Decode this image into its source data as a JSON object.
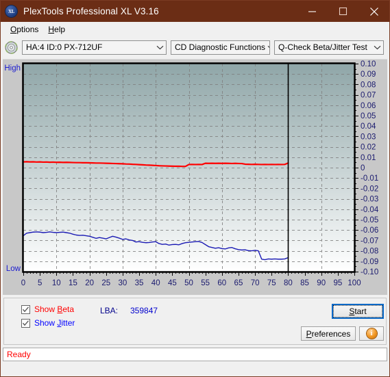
{
  "window": {
    "title": "PlexTools Professional XL V3.16",
    "icon": "xl-app-icon",
    "icon_text": "XL",
    "minimize": "minimize-icon",
    "maximize": "maximize-icon",
    "close": "close-icon",
    "titlebar_color": "#6b2d15"
  },
  "menu": {
    "items": [
      {
        "label": "Options",
        "accel": "O"
      },
      {
        "label": "Help",
        "accel": "H"
      }
    ]
  },
  "toolbar": {
    "disc_icon": "cd-disc-icon",
    "drive_select": {
      "value": "HA:4 ID:0  PX-712UF"
    },
    "function_select": {
      "value": "CD Diagnostic Functions"
    },
    "test_select": {
      "value": "Q-Check Beta/Jitter Test"
    }
  },
  "controls": {
    "show_beta": {
      "label_pre": "Show ",
      "accel": "B",
      "label_post": "eta",
      "checked": true,
      "color": "#ff0000"
    },
    "show_jitter": {
      "label_pre": "Show ",
      "accel": "J",
      "label_post": "itter",
      "checked": true,
      "color": "#0000ff"
    },
    "lba_label": "LBA:",
    "lba_value": "359847",
    "start_button": {
      "pre": "",
      "accel": "S",
      "post": "tart"
    },
    "preferences_button": {
      "pre": "",
      "accel": "P",
      "post": "references"
    },
    "info_button": {
      "icon": "info-icon",
      "glyph": "i"
    }
  },
  "status": {
    "text": "Ready",
    "color": "#ff0000"
  },
  "chart_data": {
    "type": "line",
    "title": "Q-Check Beta/Jitter Test",
    "xlabel": "",
    "ylabel": "",
    "xlim": [
      0,
      100
    ],
    "ylim": [
      -0.1,
      0.1
    ],
    "xticks": [
      0,
      5,
      10,
      15,
      20,
      25,
      30,
      35,
      40,
      45,
      50,
      55,
      60,
      65,
      70,
      75,
      80,
      85,
      90,
      95,
      100
    ],
    "yticks_right": [
      0.1,
      0.09,
      0.08,
      0.07,
      0.06,
      0.05,
      0.04,
      0.03,
      0.02,
      0.01,
      0,
      -0.01,
      -0.02,
      -0.03,
      -0.04,
      -0.05,
      -0.06,
      -0.07,
      -0.08,
      -0.09,
      -0.1
    ],
    "ylabel_top_left": "High",
    "ylabel_bottom_left": "Low",
    "grid": true,
    "grid_style": "dashed",
    "grid_color": "#808080",
    "background_gradient": [
      "#8fa6a8",
      "#ffffff"
    ],
    "progress_marker_x": 80,
    "legend": [
      {
        "name": "Beta",
        "color": "#ff0000"
      },
      {
        "name": "Jitter",
        "color": "#1a1ab4"
      }
    ],
    "series": [
      {
        "name": "Beta",
        "color": "#ff0000",
        "x": [
          0,
          1,
          2,
          3,
          4,
          5,
          6,
          7,
          8,
          9,
          10,
          11,
          12,
          13,
          14,
          15,
          16,
          17,
          18,
          19,
          20,
          21,
          22,
          23,
          24,
          25,
          26,
          27,
          28,
          29,
          30,
          31,
          32,
          33,
          34,
          35,
          36,
          37,
          38,
          39,
          40,
          41,
          42,
          43,
          44,
          45,
          46,
          47,
          48,
          49,
          50,
          51,
          52,
          53,
          54,
          55,
          56,
          57,
          58,
          59,
          60,
          61,
          62,
          63,
          64,
          65,
          66,
          67,
          68,
          69,
          70,
          71,
          72,
          73,
          74,
          75,
          76,
          77,
          78,
          79,
          80
        ],
        "y": [
          0.0055,
          0.0057,
          0.0055,
          0.0056,
          0.0054,
          0.0055,
          0.0053,
          0.0054,
          0.0052,
          0.0053,
          0.0051,
          0.0052,
          0.005,
          0.0051,
          0.005,
          0.0049,
          0.0048,
          0.0048,
          0.0047,
          0.0047,
          0.0046,
          0.0045,
          0.0044,
          0.0044,
          0.0043,
          0.0042,
          0.0041,
          0.004,
          0.0039,
          0.0038,
          0.0037,
          0.0035,
          0.0034,
          0.0032,
          0.0031,
          0.0029,
          0.0027,
          0.0025,
          0.0024,
          0.0022,
          0.002,
          0.0018,
          0.0017,
          0.0016,
          0.0015,
          0.0014,
          0.0013,
          0.0013,
          0.0012,
          0.0012,
          0.003,
          0.0031,
          0.003,
          0.0031,
          0.003,
          0.0042,
          0.0041,
          0.0042,
          0.0041,
          0.0042,
          0.0041,
          0.0042,
          0.0041,
          0.004,
          0.0041,
          0.004,
          0.0039,
          0.0033,
          0.0032,
          0.0031,
          0.0032,
          0.0031,
          0.003,
          0.0031,
          0.003,
          0.0031,
          0.003,
          0.0031,
          0.003,
          0.0031,
          0.0044
        ]
      },
      {
        "name": "Jitter",
        "color": "#1a1ab4",
        "x": [
          0,
          1,
          2,
          3,
          4,
          5,
          6,
          7,
          8,
          9,
          10,
          11,
          12,
          13,
          14,
          15,
          16,
          17,
          18,
          19,
          20,
          21,
          22,
          23,
          24,
          25,
          26,
          27,
          28,
          29,
          30,
          31,
          32,
          33,
          34,
          35,
          36,
          37,
          38,
          39,
          40,
          41,
          42,
          43,
          44,
          45,
          46,
          47,
          48,
          49,
          50,
          51,
          52,
          53,
          54,
          55,
          56,
          57,
          58,
          59,
          60,
          61,
          62,
          63,
          64,
          65,
          66,
          67,
          68,
          69,
          70,
          71,
          72,
          73,
          74,
          75,
          76,
          77,
          78,
          79,
          80
        ],
        "y": [
          -0.0655,
          -0.063,
          -0.0625,
          -0.062,
          -0.0618,
          -0.062,
          -0.0625,
          -0.0622,
          -0.0618,
          -0.0622,
          -0.0625,
          -0.0622,
          -0.062,
          -0.0625,
          -0.063,
          -0.064,
          -0.0648,
          -0.0652,
          -0.065,
          -0.0655,
          -0.066,
          -0.067,
          -0.068,
          -0.0672,
          -0.0678,
          -0.0685,
          -0.0672,
          -0.066,
          -0.0668,
          -0.0678,
          -0.069,
          -0.0685,
          -0.0695,
          -0.07,
          -0.0715,
          -0.0712,
          -0.0718,
          -0.0722,
          -0.072,
          -0.0715,
          -0.0712,
          -0.073,
          -0.0738,
          -0.0735,
          -0.0745,
          -0.074,
          -0.0738,
          -0.0742,
          -0.073,
          -0.0722,
          -0.0718,
          -0.0715,
          -0.0712,
          -0.071,
          -0.072,
          -0.074,
          -0.076,
          -0.0768,
          -0.0775,
          -0.077,
          -0.0778,
          -0.0782,
          -0.0772,
          -0.0768,
          -0.078,
          -0.0788,
          -0.0792,
          -0.079,
          -0.0798,
          -0.08,
          -0.0795,
          -0.08,
          -0.088,
          -0.0885,
          -0.0878,
          -0.088,
          -0.0878,
          -0.088,
          -0.088,
          -0.0878,
          -0.0865
        ]
      }
    ]
  }
}
